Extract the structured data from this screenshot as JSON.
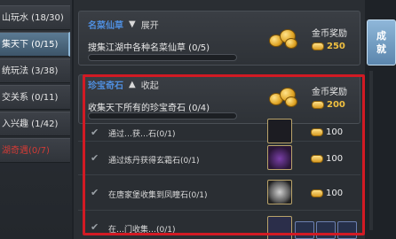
{
  "sidebar": {
    "items": [
      {
        "label": "山玩水 (18/30)"
      },
      {
        "label": "集天下 (0/15)"
      },
      {
        "label": "统玩法 (3/38)"
      },
      {
        "label": "交关系 (0/11)"
      },
      {
        "label": "入兴趣 (1/42)"
      },
      {
        "label": "湖奇遇(0/7)"
      }
    ]
  },
  "sections": [
    {
      "title": "名菜仙草",
      "toggle_label": "展开",
      "task_desc": "搜集江湖中各种名菜仙草 (0/5)",
      "progress": 0,
      "reward_title": "金币奖励",
      "reward_value": "250"
    },
    {
      "title": "珍宝奇石",
      "toggle_label": "收起",
      "task_desc": "收集天下所有的珍宝奇石 (0/4)",
      "progress": 0,
      "reward_title": "金币奖励",
      "reward_value": "200"
    }
  ],
  "subtasks": [
    {
      "text": "通过…获…石(0/1)",
      "reward": "100"
    },
    {
      "text": "通过炼丹获得玄霜石(0/1)",
      "reward": "100"
    },
    {
      "text": "在唐家堡收集到凤瞳石(0/1)",
      "reward": "100"
    },
    {
      "text": "在…门收集…(0/1)",
      "reward": ""
    }
  ],
  "right_button": {
    "line1": "成",
    "line2": "就"
  },
  "colors": {
    "section_title": "#4f8fe0",
    "reward_gold": "#f0c040",
    "highlight_frame": "#d21a24",
    "danger_text": "#d23b36"
  }
}
